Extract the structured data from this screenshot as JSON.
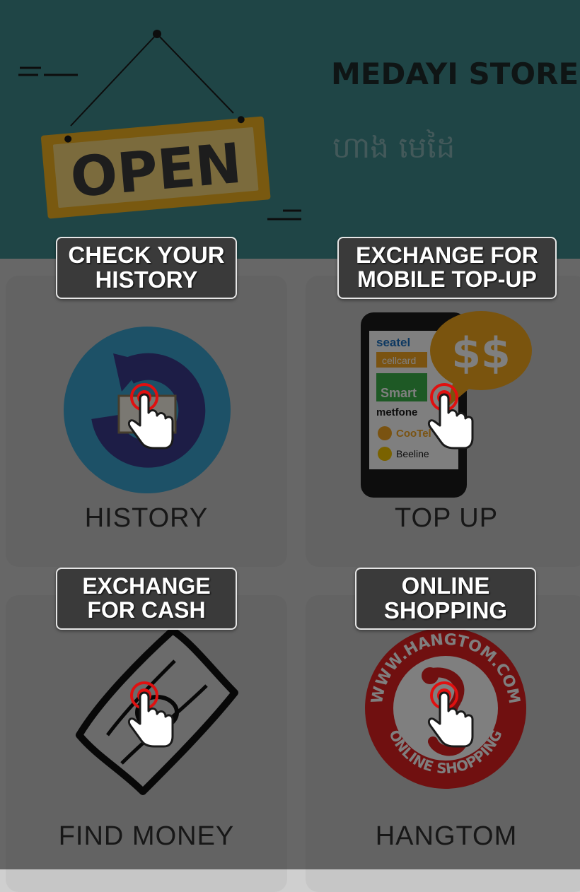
{
  "header": {
    "store_name": "MEDAYI STORE",
    "store_name_khmer": "ហាង មេដៃ",
    "sign_text": "OPEN",
    "background_color": "#3e8a8c"
  },
  "menu": [
    {
      "label": "HISTORY",
      "icon": "history-book-icon",
      "tip_lines": [
        "CHECK YOUR",
        "HISTORY"
      ]
    },
    {
      "label": "TOP UP",
      "icon": "mobile-topup-icon",
      "tip_lines": [
        "EXCHANGE FOR",
        "MOBILE TOP-UP"
      ]
    },
    {
      "label": "FIND MONEY",
      "icon": "money-bill-icon",
      "tip_lines": [
        "EXCHANGE",
        "FOR CASH"
      ]
    },
    {
      "label": "HANGTOM",
      "icon": "hangtom-logo-icon",
      "tip_lines": [
        "ONLINE",
        "SHOPPING"
      ]
    }
  ],
  "topup_phone": {
    "carriers": [
      "seatel",
      "cellcard",
      "Smart",
      "metfone",
      "CooTel",
      "Beeline"
    ],
    "bubble_text": "$$"
  },
  "hangtom_logo": {
    "ring_top": "WWW.HANGTOM.COM",
    "ring_bottom": "ONLINE SHOPPING"
  },
  "overlay_color": "rgba(0,0,0,0.5)",
  "tap_indicator_color": "#e01010"
}
